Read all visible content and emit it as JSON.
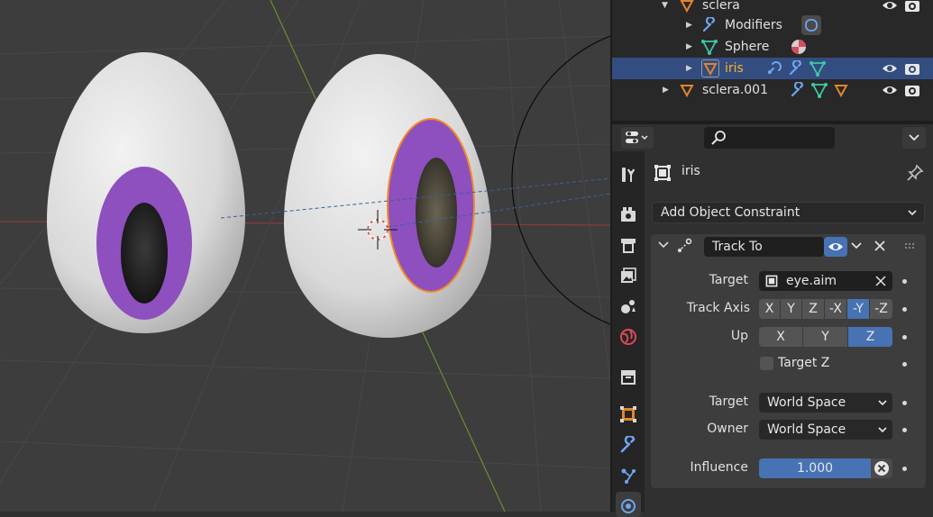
{
  "outliner": {
    "rows": [
      {
        "label": "sclera"
      },
      {
        "label": "Modifiers"
      },
      {
        "label": "Sphere"
      },
      {
        "label": "iris"
      },
      {
        "label": "sclera.001"
      }
    ]
  },
  "properties": {
    "search_placeholder": "",
    "object_name": "iris",
    "add_constraint_label": "Add Object Constraint",
    "constraint": {
      "name": "Track To",
      "target_label": "Target",
      "target_value": "eye.aim",
      "track_axis_label": "Track Axis",
      "track_axis_options": [
        "X",
        "Y",
        "Z",
        "-X",
        "-Y",
        "-Z"
      ],
      "track_axis_selected": "-Y",
      "up_label": "Up",
      "up_options": [
        "X",
        "Y",
        "Z"
      ],
      "up_selected": "Z",
      "target_z_label": "Target Z",
      "target_z_checked": false,
      "target_space_label": "Target",
      "target_space_value": "World Space",
      "owner_space_label": "Owner",
      "owner_space_value": "World Space",
      "influence_label": "Influence",
      "influence_value": "1.000"
    }
  },
  "colors": {
    "selection": "#334d80",
    "accent": "#4772b3",
    "iris": "#8e4fbf",
    "object_orange": "#e2862a",
    "mesh_green": "#3ec7a6",
    "modifier_blue": "#6fa4f0"
  }
}
